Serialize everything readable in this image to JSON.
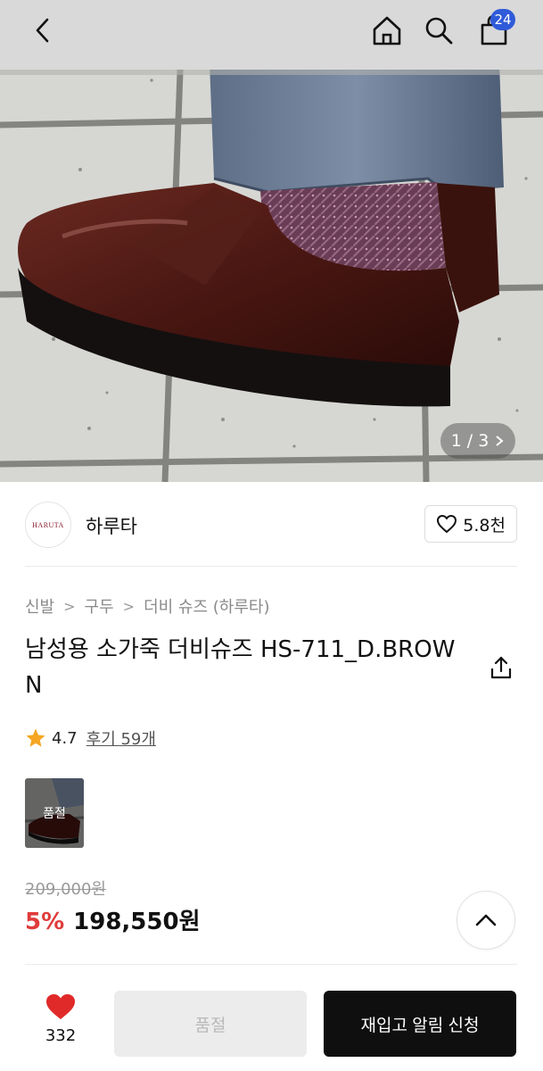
{
  "header": {
    "cart_count": "24"
  },
  "gallery": {
    "current": "1",
    "separator": "/",
    "total": "3"
  },
  "seller": {
    "logo_text": "HARUTA",
    "name": "하루타",
    "likes": "5.8천"
  },
  "breadcrumb": [
    "신발",
    "구두",
    "더비 슈즈 (하루타)"
  ],
  "product": {
    "title": "남성용 소가죽 더비슈즈 HS-711_D.BROWN",
    "rating": "4.7",
    "reviews_label": "후기 59개",
    "option_label": "품절",
    "original_price": "209,000원",
    "discount": "5%",
    "sale_price": "198,550원"
  },
  "bottom": {
    "wish_count": "332",
    "soldout_label": "품절",
    "restock_label": "재입고 알림 신청"
  },
  "colors": {
    "accent_blue": "#2f5bd9",
    "discount_red": "#e03b3b",
    "heart_red": "#e02a2a",
    "primary_black": "#0f0f0f"
  }
}
